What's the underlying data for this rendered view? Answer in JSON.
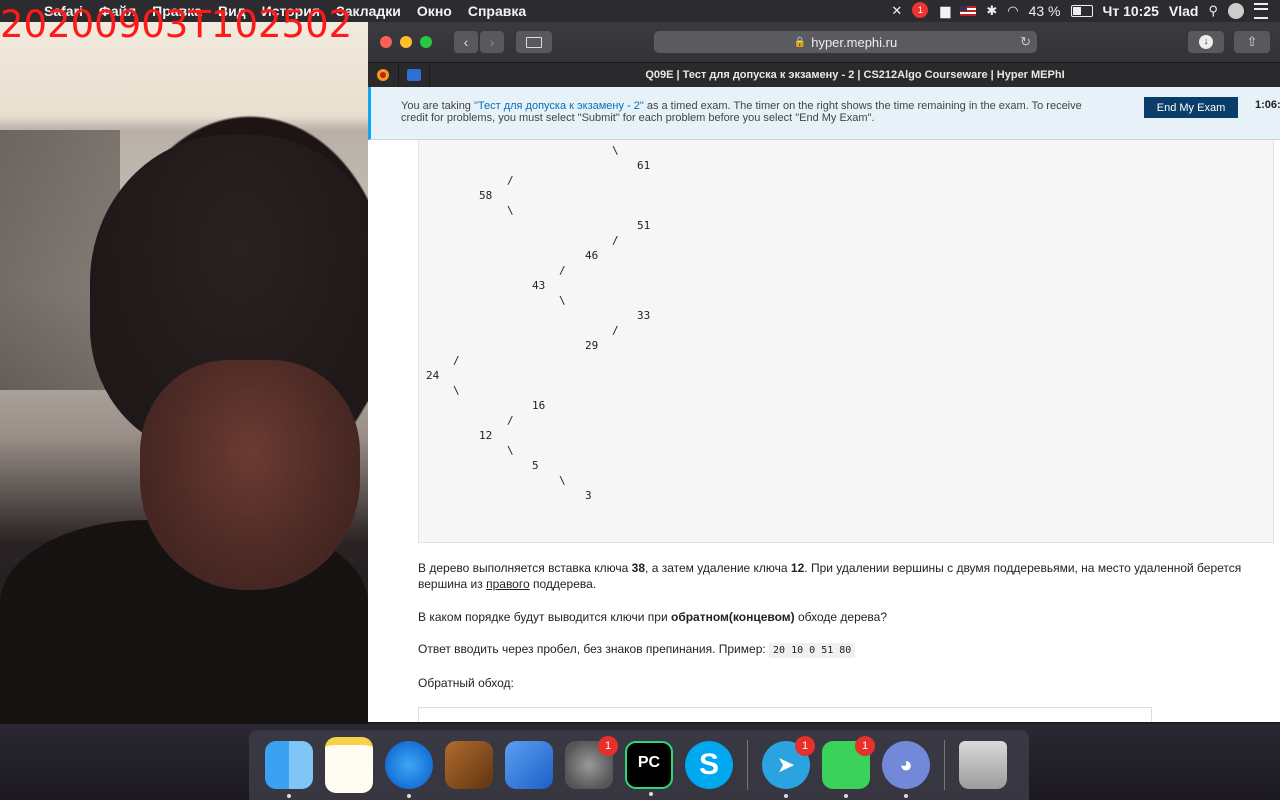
{
  "menubar": {
    "app_name": "Safari",
    "items": [
      "Файл",
      "Правка",
      "Вид",
      "История",
      "Закладки",
      "Окно",
      "Справка"
    ],
    "battery": "43 %",
    "clock": "Чт 10:25",
    "user": "Vlad",
    "notification_badge": "1"
  },
  "overlay": {
    "timestamp": "20200903T102502"
  },
  "browser": {
    "url": "hyper.mephi.ru",
    "tab_title": "Q09E | Тест для допуска к экзамену - 2 | CS212Algo Courseware | Hyper MEPhI"
  },
  "banner": {
    "text_before": "You are taking ",
    "exam_link": "\"Тест для допуска к экзамену - 2\"",
    "text_after": " as a timed exam. The timer on the right shows the time remaining in the exam. To receive credit for problems, you must select \"Submit\" for each problem before you select \"End My Exam\".",
    "end_button": "End My Exam",
    "timer": "1:06:"
  },
  "tree": {
    "edges": [
      "\\",
      "/",
      "\\",
      "/",
      "/",
      "\\",
      "/",
      "/",
      "\\",
      "/",
      "\\",
      "\\"
    ],
    "nodes": [
      "61",
      "58",
      "51",
      "46",
      "43",
      "33",
      "29",
      "24",
      "16",
      "12",
      "5",
      "3"
    ]
  },
  "question": {
    "p1_a": "В дерево выполняется вставка ключа ",
    "p1_key1": "38",
    "p1_b": ", а затем удаление ключа ",
    "p1_key2": "12",
    "p1_c": ". При удалении вершины с двумя поддеревьями, на место удаленной берется вершина из ",
    "p1_right": "правого",
    "p1_d": " поддерева.",
    "p2_a": "В каком порядке будут выводится ключи при ",
    "p2_bold": "обратном(концевом)",
    "p2_b": " обходе дерева?",
    "p3_a": "Ответ вводить через пробел, без знаков препинания. Пример: ",
    "p3_example": "20 10 0 51 80",
    "p4": "Обратный обход:"
  },
  "dock": {
    "badges": {
      "system_preferences": "1",
      "telegram": "1",
      "facetime": "1"
    }
  }
}
